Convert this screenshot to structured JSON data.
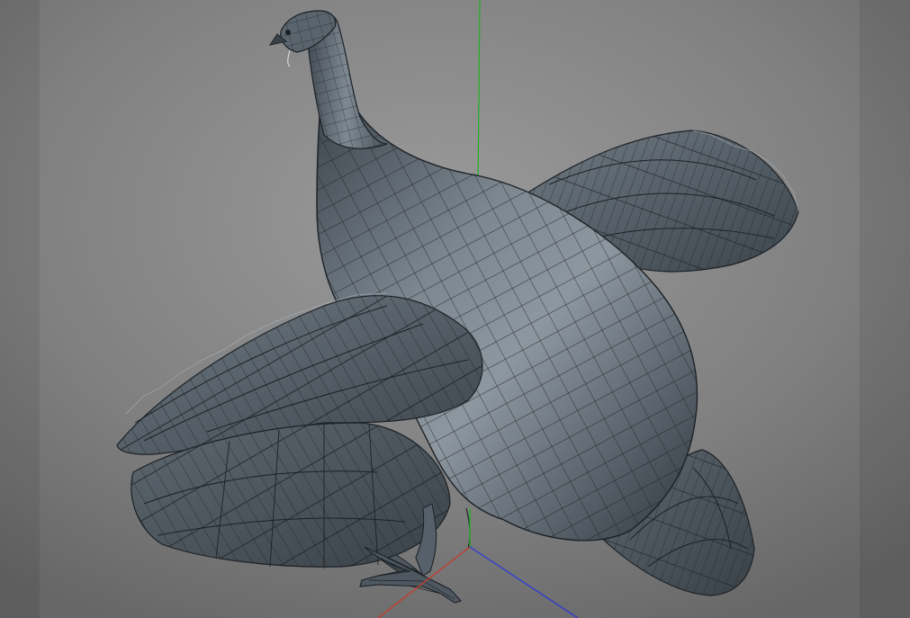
{
  "viewport": {
    "background_center": "#8d8d8d",
    "background_edge": "#5f5f5f",
    "frame_band_color": "#5a5a5a"
  },
  "model": {
    "subject": "capercaillie-bird-wireframe",
    "surface_color": "#5d6770",
    "wire_color": "#1e2328",
    "highlight_color": "#a9b2ba",
    "shadow_color": "#2d3338"
  },
  "axes": {
    "x_color": "#c83a2a",
    "y_color": "#22b022",
    "z_color": "#2e3ad8"
  }
}
